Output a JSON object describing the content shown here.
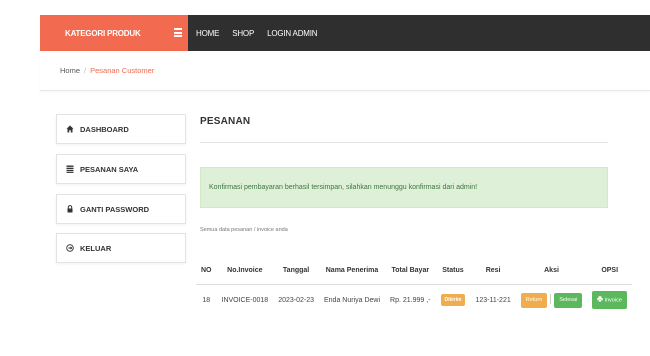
{
  "header": {
    "brand": "KATEGORI PRODUK",
    "nav": [
      {
        "label": "HOME"
      },
      {
        "label": "SHOP"
      },
      {
        "label": "LOGIN ADMIN"
      }
    ]
  },
  "breadcrumb": {
    "home": "Home",
    "separator": "/",
    "current": "Pesanan Customer"
  },
  "sidebar": {
    "items": [
      {
        "label": "DASHBOARD",
        "icon": "home-icon"
      },
      {
        "label": "PESANAN SAYA",
        "icon": "list-icon"
      },
      {
        "label": "GANTI PASSWORD",
        "icon": "lock-icon"
      },
      {
        "label": "KELUAR",
        "icon": "logout-icon"
      }
    ]
  },
  "main": {
    "title": "PESANAN",
    "alert": "Konfirmasi pembayaran berhasil tersimpan, silahkan menunggu konfirmasi dari admin!",
    "note": "Semua data pesanan / invoice anda",
    "table": {
      "headers": [
        "NO",
        "No.Invoice",
        "Tanggal",
        "Nama Penerima",
        "Total Bayar",
        "Status",
        "Resi",
        "Aksi",
        "OPSI"
      ],
      "rows": [
        {
          "no": "18",
          "invoice": "INVOICE-0018",
          "tanggal": "2023-02-23",
          "nama": "Enda Nuriya Dewi",
          "total": "Rp. 21.999 ,-",
          "status": "Dikirim",
          "resi": "123-11-221",
          "aksi_return": "Return",
          "aksi_selesai": "Selesai",
          "opsi": "Invoice"
        }
      ]
    }
  },
  "colors": {
    "brand": "#f26a4f",
    "topbar": "#2f2f2f",
    "alert_bg": "#dff0d8",
    "warning": "#f0ad4e",
    "success": "#5cb85c"
  }
}
